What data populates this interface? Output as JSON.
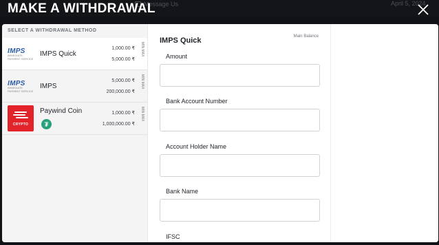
{
  "background": {
    "message_link": "Message Us",
    "date": "April 5, 2024"
  },
  "header": {
    "title": "MAKE A WITHDRAWAL"
  },
  "methods": {
    "title": "SELECT A WITHDRAWAL METHOD",
    "min_label": "MIN",
    "max_label": "MAX",
    "items": [
      {
        "name": "IMPS Quick",
        "logo": "IMPS",
        "logo_sub": "IMMEDIATE PAYMENT SERVICE",
        "min": "1,000.00 ₹",
        "max": "5,000.00 ₹",
        "active": true
      },
      {
        "name": "IMPS",
        "logo": "IMPS",
        "logo_sub": "IMMEDIATE PAYMENT SERVICE",
        "min": "5,000.00 ₹",
        "max": "200,000.00 ₹",
        "active": false
      },
      {
        "name": "Paywind Coin",
        "logo": "CRYPTO",
        "badge": "₮",
        "min": "1,000.00 ₹",
        "max": "1,000,000.00 ₹",
        "active": false
      }
    ]
  },
  "form": {
    "title": "IMPS Quick",
    "balance_label": "Main Balance",
    "fields": [
      {
        "label": "Amount",
        "value": ""
      },
      {
        "label": "Bank Account Number",
        "value": ""
      },
      {
        "label": "Bank Account Holder Name",
        "display_label": "Account Holder Name",
        "value": ""
      },
      {
        "label": "Bank Name",
        "value": ""
      },
      {
        "label": "IFSC",
        "value": ""
      }
    ]
  },
  "colors": {
    "crypto_red": "#e2232a",
    "tether_green": "#26a17b",
    "imps_blue": "#2b5aa8"
  }
}
